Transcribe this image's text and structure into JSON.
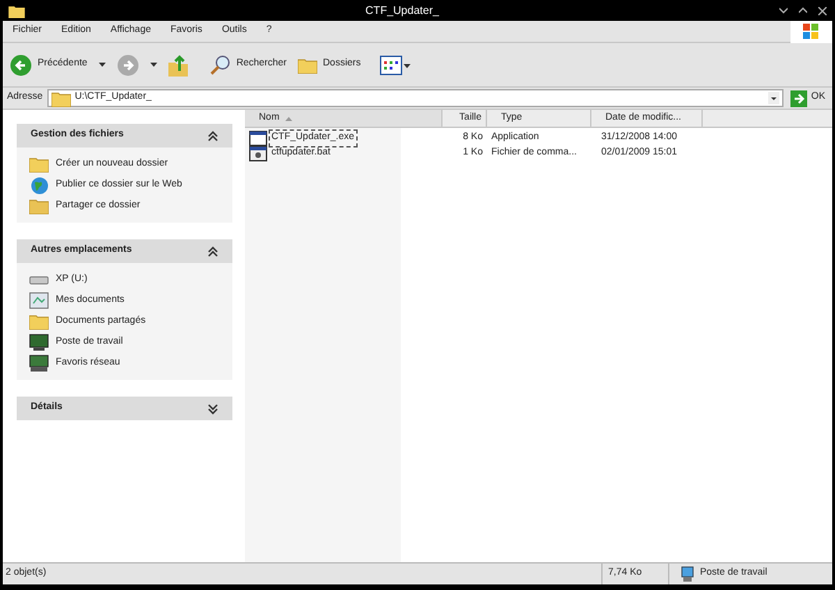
{
  "window": {
    "title": "CTF_Updater_"
  },
  "menu": [
    "Fichier",
    "Edition",
    "Affichage",
    "Favoris",
    "Outils",
    "?"
  ],
  "toolbar": {
    "back": "Précédente",
    "search": "Rechercher",
    "folders": "Dossiers"
  },
  "address": {
    "label": "Adresse",
    "value": "U:\\CTF_Updater_",
    "go": "OK"
  },
  "sidebar": [
    {
      "title": "Gestion des fichiers",
      "expanded": true,
      "items": [
        {
          "kind": "folder-new",
          "label": "Créer un nouveau dossier"
        },
        {
          "kind": "globe",
          "label": "Publier ce dossier sur le Web"
        },
        {
          "kind": "folder-share",
          "label": "Partager ce dossier"
        }
      ]
    },
    {
      "title": "Autres emplacements",
      "expanded": true,
      "items": [
        {
          "kind": "drive",
          "label": "XP (U:)"
        },
        {
          "kind": "docs",
          "label": "Mes documents"
        },
        {
          "kind": "folder",
          "label": "Documents partagés"
        },
        {
          "kind": "computer",
          "label": "Poste de travail"
        },
        {
          "kind": "network",
          "label": "Favoris réseau"
        }
      ]
    },
    {
      "title": "Détails",
      "expanded": false
    }
  ],
  "table": {
    "columns": [
      {
        "label": "Nom",
        "sorted": true
      },
      {
        "label": "Taille",
        "sorted": false
      },
      {
        "label": "Type",
        "sorted": false
      },
      {
        "label": "Date de modific...",
        "sorted": false
      }
    ],
    "rows": [
      {
        "kind": "exe",
        "selected": true,
        "cells": [
          "CTF_Updater_.exe",
          "8 Ko",
          "Application",
          "31/12/2008 14:00"
        ]
      },
      {
        "kind": "bat",
        "selected": false,
        "cells": [
          "ctfupdater.bat",
          "1 Ko",
          "Fichier de comma...",
          "02/01/2009 15:01"
        ]
      }
    ]
  },
  "status_bar": {
    "objects": "2 objet(s)",
    "size": "7,74 Ko",
    "location": "Poste de travail"
  }
}
